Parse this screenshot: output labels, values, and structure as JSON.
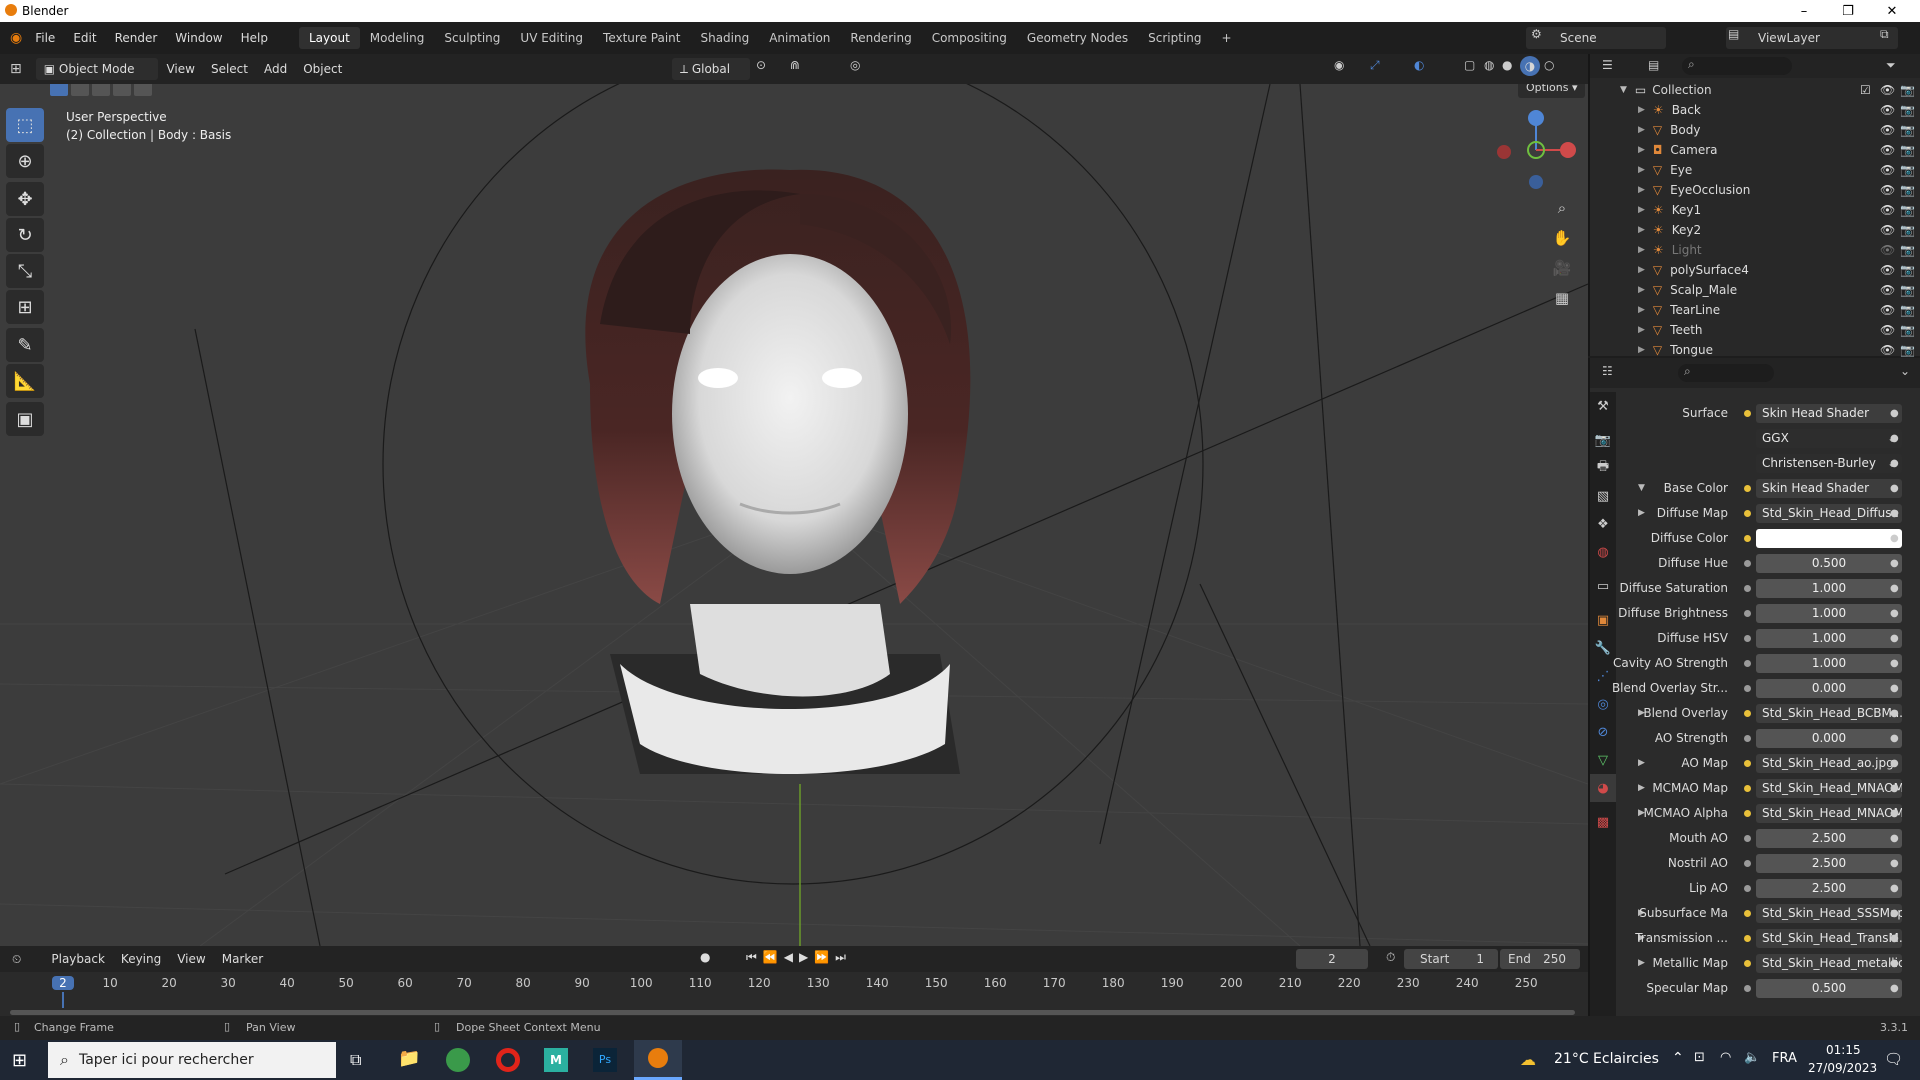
{
  "titlebar": {
    "title": "Blender",
    "min": "–",
    "max": "❐",
    "close": "✕"
  },
  "menus": [
    "File",
    "Edit",
    "Render",
    "Window",
    "Help"
  ],
  "workspaces": [
    "Layout",
    "Modeling",
    "Sculpting",
    "UV Editing",
    "Texture Paint",
    "Shading",
    "Animation",
    "Rendering",
    "Compositing",
    "Geometry Nodes",
    "Scripting",
    "+"
  ],
  "scene": {
    "scene_name": "Scene",
    "view_layer": "ViewLayer"
  },
  "viewport_header": {
    "mode": "Object Mode",
    "menus": [
      "View",
      "Select",
      "Add",
      "Object"
    ],
    "orientation": "Global"
  },
  "viewport": {
    "perspective": "User Perspective",
    "context": "(2) Collection | Body : Basis",
    "options_label": "Options ▾"
  },
  "outliner": {
    "collection": "Collection",
    "items": [
      {
        "name": "Back",
        "dim": false
      },
      {
        "name": "Body",
        "dim": false
      },
      {
        "name": "Camera",
        "dim": false
      },
      {
        "name": "Eye",
        "dim": false
      },
      {
        "name": "EyeOcclusion",
        "dim": false
      },
      {
        "name": "Key1",
        "dim": false
      },
      {
        "name": "Key2",
        "dim": false
      },
      {
        "name": "Light",
        "dim": true
      },
      {
        "name": "polySurface4",
        "dim": false
      },
      {
        "name": "Scalp_Male",
        "dim": false
      },
      {
        "name": "TearLine",
        "dim": false
      },
      {
        "name": "Teeth",
        "dim": false
      },
      {
        "name": "Tongue",
        "dim": false
      }
    ]
  },
  "properties": {
    "rows": [
      {
        "label": "Surface",
        "value": "Skin Head Shader",
        "kind": "link",
        "arrow": ""
      },
      {
        "label": "",
        "value": "GGX",
        "kind": "dropdown",
        "arrow": ""
      },
      {
        "label": "",
        "value": "Christensen-Burley",
        "kind": "dropdown",
        "arrow": ""
      },
      {
        "label": "Base Color",
        "value": "Skin Head Shader",
        "kind": "link",
        "arrow": "▼"
      },
      {
        "label": "Diffuse Map",
        "value": "Std_Skin_Head_Diffuse",
        "kind": "link",
        "arrow": "▶"
      },
      {
        "label": "Diffuse Color",
        "value": "",
        "kind": "color",
        "arrow": ""
      },
      {
        "label": "Diffuse Hue",
        "value": "0.500",
        "kind": "num",
        "arrow": ""
      },
      {
        "label": "Diffuse Saturation",
        "value": "1.000",
        "kind": "num",
        "arrow": ""
      },
      {
        "label": "Diffuse Brightness",
        "value": "1.000",
        "kind": "num",
        "arrow": ""
      },
      {
        "label": "Diffuse HSV",
        "value": "1.000",
        "kind": "num",
        "arrow": ""
      },
      {
        "label": "Cavity AO Strength",
        "value": "1.000",
        "kind": "num",
        "arrow": ""
      },
      {
        "label": "Blend Overlay Str...",
        "value": "0.000",
        "kind": "num",
        "arrow": ""
      },
      {
        "label": "Blend Overlay",
        "value": "Std_Skin_Head_BCBMa...",
        "kind": "link",
        "arrow": "▶"
      },
      {
        "label": "AO Strength",
        "value": "0.000",
        "kind": "num",
        "arrow": ""
      },
      {
        "label": "AO Map",
        "value": "Std_Skin_Head_ao.jpg",
        "kind": "link",
        "arrow": "▶"
      },
      {
        "label": "MCMAO Map",
        "value": "Std_Skin_Head_MNAOM",
        "kind": "link",
        "arrow": "▶"
      },
      {
        "label": "MCMAO Alpha",
        "value": "Std_Skin_Head_MNAOM",
        "kind": "link",
        "arrow": "▶"
      },
      {
        "label": "Mouth AO",
        "value": "2.500",
        "kind": "num",
        "arrow": ""
      },
      {
        "label": "Nostril AO",
        "value": "2.500",
        "kind": "num",
        "arrow": ""
      },
      {
        "label": "Lip AO",
        "value": "2.500",
        "kind": "num",
        "arrow": ""
      },
      {
        "label": "Subsurface Ma",
        "value": "Std_Skin_Head_SSSMap...",
        "kind": "link",
        "arrow": "▶"
      },
      {
        "label": "Transmission ...",
        "value": "Std_Skin_Head_TransM...",
        "kind": "link",
        "arrow": "▶"
      },
      {
        "label": "Metallic Map",
        "value": "Std_Skin_Head_metallic",
        "kind": "link",
        "arrow": "▶"
      },
      {
        "label": "Specular Map",
        "value": "0.500",
        "kind": "num",
        "arrow": ""
      }
    ]
  },
  "timeline": {
    "menus": [
      "Playback",
      "Keying",
      "View",
      "Marker"
    ],
    "current_frame": "2",
    "start_label": "Start",
    "start": "1",
    "end_label": "End",
    "end": "250",
    "ticks": [
      "2",
      "10",
      "20",
      "30",
      "40",
      "50",
      "60",
      "70",
      "80",
      "90",
      "100",
      "110",
      "120",
      "130",
      "140",
      "150",
      "160",
      "170",
      "180",
      "190",
      "200",
      "210",
      "220",
      "230",
      "240",
      "250"
    ]
  },
  "statusbar": {
    "change_frame": "Change Frame",
    "pan_view": "Pan View",
    "context_menu": "Dope Sheet Context Menu",
    "version": "3.3.1"
  },
  "taskbar": {
    "search_placeholder": "Taper ici pour rechercher",
    "weather": "21°C  Eclaircies",
    "lang": "FRA",
    "time": "01:15",
    "date": "27/09/2023"
  },
  "colors": {
    "accent": "#4772b3",
    "object_orange": "#e0883a",
    "link_yellow": "#e8c03a",
    "mesh_green": "#5fc76a"
  }
}
